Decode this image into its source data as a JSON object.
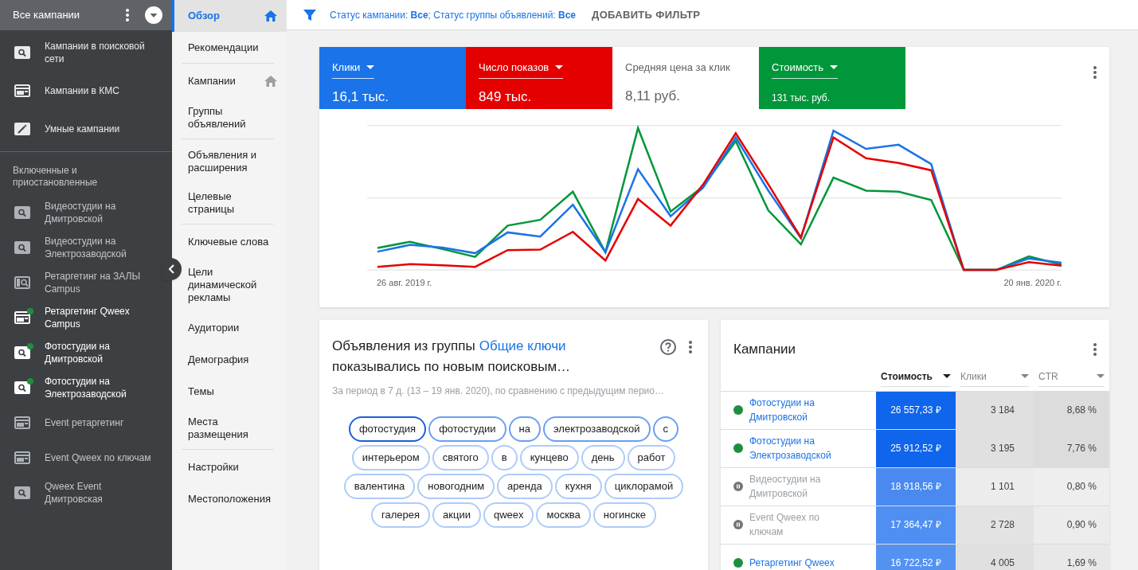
{
  "sidebar": {
    "header": {
      "title": "Все кампании"
    },
    "top_items": [
      {
        "label": "Кампании в поисковой сети",
        "kind": "search"
      },
      {
        "label": "Кампании в КМС",
        "kind": "display"
      },
      {
        "label": "Умные кампании",
        "kind": "smart"
      }
    ],
    "section_title": "Включенные и приостановленные",
    "campaigns": [
      {
        "label": "Видеостудии на Дмитровской",
        "kind": "search",
        "active": false
      },
      {
        "label": "Видеостудии на Электрозаводской",
        "kind": "search",
        "active": false
      },
      {
        "label": "Ретаргетинг на ЗАЛЫ Campus",
        "kind": "audience",
        "active": false
      },
      {
        "label": "Ретаргетинг Qweex Campus",
        "kind": "display",
        "active": true
      },
      {
        "label": "Фотостудии на Дмитровской",
        "kind": "search",
        "active": true
      },
      {
        "label": "Фотостудии на Электрозаводской",
        "kind": "search",
        "active": true
      },
      {
        "label": "Event ретаргетинг",
        "kind": "display",
        "active": false
      },
      {
        "label": "Event Qweex по ключам",
        "kind": "display",
        "active": false
      },
      {
        "label": "Qweex Event Дмитровская",
        "kind": "search",
        "active": false
      }
    ]
  },
  "nav": {
    "items": [
      {
        "label": "Обзор",
        "selected": true,
        "home_icon": true,
        "divider_after": false
      },
      {
        "label": "Рекомендации",
        "selected": false,
        "home_icon": false,
        "divider_after": true
      },
      {
        "label": "Кампании",
        "selected": false,
        "home_icon": true,
        "divider_after": false
      },
      {
        "label": "Группы объявлений",
        "selected": false,
        "home_icon": false,
        "divider_after": true
      },
      {
        "label": "Объявления и расширения",
        "selected": false,
        "home_icon": false,
        "divider_after": false
      },
      {
        "label": "Целевые страницы",
        "selected": false,
        "home_icon": false,
        "divider_after": true
      },
      {
        "label": "Ключевые слова",
        "selected": false,
        "home_icon": false,
        "divider_after": false
      },
      {
        "label": "Цели динамической рекламы",
        "selected": false,
        "home_icon": false,
        "divider_after": false
      },
      {
        "label": "Аудитории",
        "selected": false,
        "home_icon": false,
        "divider_after": false
      },
      {
        "label": "Демография",
        "selected": false,
        "home_icon": false,
        "divider_after": false
      },
      {
        "label": "Темы",
        "selected": false,
        "home_icon": false,
        "divider_after": false
      },
      {
        "label": "Места размещения",
        "selected": false,
        "home_icon": false,
        "divider_after": true
      },
      {
        "label": "Настройки",
        "selected": false,
        "home_icon": false,
        "divider_after": false
      },
      {
        "label": "Местоположения",
        "selected": false,
        "home_icon": false,
        "divider_after": false
      }
    ]
  },
  "filter_bar": {
    "status": "Статус кампании: **Все**; Статус группы объявлений: **Все**",
    "add_filter": "ДОБАВИТЬ ФИЛЬТР"
  },
  "metrics": [
    {
      "label": "Клики",
      "value": "16,1 тыс.",
      "selected": true,
      "color": "#1a73e8",
      "compact": false
    },
    {
      "label": "Число показов",
      "value": "849 тыс.",
      "selected": true,
      "color": "#e50000",
      "compact": false
    },
    {
      "label": "Средняя цена за клик",
      "value": "8,11 руб.",
      "selected": false,
      "compact": false
    },
    {
      "label": "Стоимость",
      "value": "131 тыс. руб.",
      "selected": true,
      "color": "#00963a",
      "compact": true
    }
  ],
  "chart": {
    "start_label": "26 авг. 2019 г.",
    "end_label": "20 янв. 2020 г."
  },
  "insight_card": {
    "title_prefix": "Объявления из группы",
    "title_link": "Общие ключи",
    "title_suffix": "показывались по новым поисковым…",
    "subtitle": "За период в 7 д. (13 – 19 янв. 2020), по сравнению с предыдущим перио…",
    "chips": [
      {
        "label": "фотостудия",
        "kind": "strong"
      },
      {
        "label": "фотостудии",
        "kind": "medium"
      },
      {
        "label": "на",
        "kind": "medium"
      },
      {
        "label": "электрозаводской",
        "kind": "medium"
      },
      {
        "label": "с",
        "kind": "medium"
      },
      {
        "label": "интерьером",
        "kind": "light"
      },
      {
        "label": "святого",
        "kind": "light"
      },
      {
        "label": "в",
        "kind": "light"
      },
      {
        "label": "кунцево",
        "kind": "light"
      },
      {
        "label": "день",
        "kind": "light"
      },
      {
        "label": "работ",
        "kind": "light"
      },
      {
        "label": "валентина",
        "kind": "light"
      },
      {
        "label": "новогодним",
        "kind": "light"
      },
      {
        "label": "аренда",
        "kind": "light"
      },
      {
        "label": "кухня",
        "kind": "light"
      },
      {
        "label": "циклорамой",
        "kind": "light"
      },
      {
        "label": "галерея",
        "kind": "light"
      },
      {
        "label": "акции",
        "kind": "light"
      },
      {
        "label": "qweex",
        "kind": "light"
      },
      {
        "label": "москва",
        "kind": "light"
      },
      {
        "label": "ногинске",
        "kind": "light"
      }
    ]
  },
  "campaigns_card": {
    "title": "Кампании",
    "columns": [
      {
        "label": "Стоимость",
        "sorted": true
      },
      {
        "label": "Клики",
        "sorted": false
      },
      {
        "label": "CTR",
        "sorted": false
      }
    ],
    "rows": [
      {
        "name": "Фотостудии на Дмитровской",
        "paused": false,
        "cost": "26 557,33 ₽",
        "clicks": "3 184",
        "ctr": "8,68 %"
      },
      {
        "name": "Фотостудии на Электрозаводской",
        "paused": false,
        "cost": "25 912,52 ₽",
        "clicks": "3 195",
        "ctr": "7,76 %"
      },
      {
        "name": "Видеостудии на Дмитровской",
        "paused": true,
        "cost": "18 918,56 ₽",
        "clicks": "1 101",
        "ctr": "0,80 %"
      },
      {
        "name": "Event Qweex по ключам",
        "paused": true,
        "cost": "17 364,47 ₽",
        "clicks": "2 728",
        "ctr": "0,90 %"
      },
      {
        "name": "Ретаргетинг Qweex",
        "paused": false,
        "cost": "16 722,52 ₽",
        "clicks": "4 005",
        "ctr": "1,69 %"
      }
    ]
  }
}
